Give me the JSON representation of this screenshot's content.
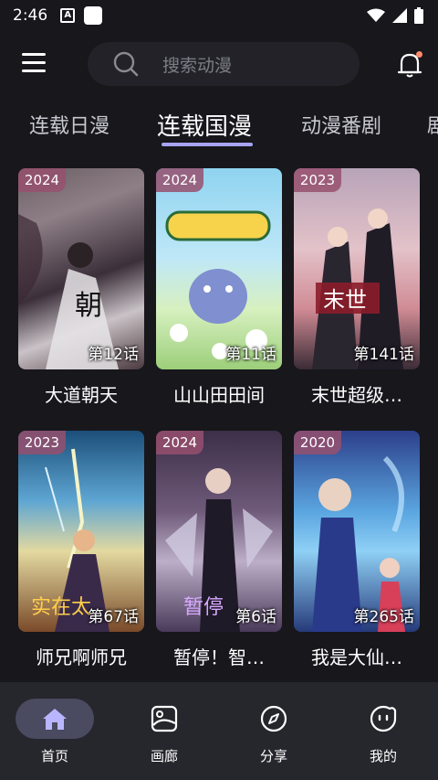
{
  "status_bar": {
    "time": "2:46",
    "notif_letter": "A"
  },
  "search": {
    "placeholder": "搜索动漫"
  },
  "tabs": [
    {
      "label": "连载日漫",
      "active": false
    },
    {
      "label": "连载国漫",
      "active": true
    },
    {
      "label": "动漫番剧",
      "active": false
    },
    {
      "label": "剧",
      "active": false
    }
  ],
  "cards": [
    {
      "year": "2024",
      "episode": "第12话",
      "title": "大道朝天"
    },
    {
      "year": "2024",
      "episode": "第11话",
      "title": "山山田田间"
    },
    {
      "year": "2023",
      "episode": "第141话",
      "title": "末世超级…"
    },
    {
      "year": "2023",
      "episode": "第67话",
      "title": "师兄啊师兄"
    },
    {
      "year": "2024",
      "episode": "第6话",
      "title": "暂停！智…"
    },
    {
      "year": "2020",
      "episode": "第265话",
      "title": "我是大仙…"
    }
  ],
  "bottom_nav": [
    {
      "label": "首页",
      "icon": "home-icon",
      "active": true
    },
    {
      "label": "画廊",
      "icon": "gallery-icon",
      "active": false
    },
    {
      "label": "分享",
      "icon": "compass-icon",
      "active": false
    },
    {
      "label": "我的",
      "icon": "profile-icon",
      "active": false
    }
  ],
  "colors": {
    "background": "#17171c",
    "accent": "#a8a4f0",
    "badge": "#96506e",
    "nav_bg": "#26262d"
  }
}
